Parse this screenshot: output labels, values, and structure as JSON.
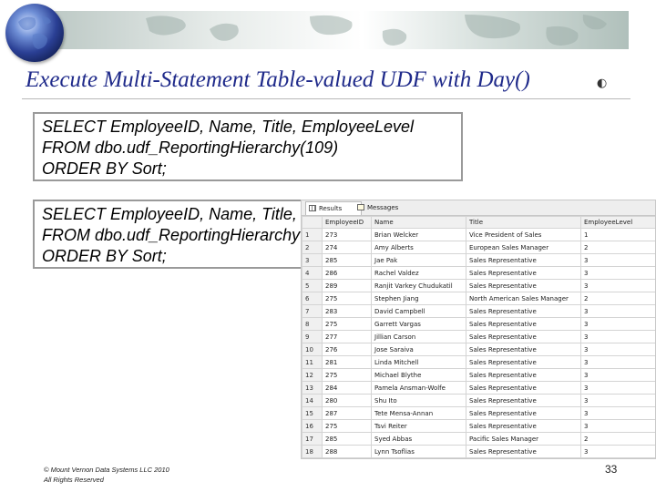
{
  "slide": {
    "title": "Execute Multi-Statement Table-valued UDF with Day()",
    "page_number": "33",
    "footer_lines": [
      "© Mount Vernon Data Systems LLC 2010",
      "All Rights Reserved"
    ],
    "icons": {
      "globe": "globe-icon",
      "title_marker": "audio-icon"
    }
  },
  "queries": [
    {
      "lines": [
        "SELECT EmployeeID, Name, Title, EmployeeLevel",
        "FROM dbo.udf_ReportingHierarchy(109)",
        "ORDER BY Sort;"
      ]
    },
    {
      "lines": [
        "SELECT EmployeeID, Name, Title, EmployeeLevel",
        "FROM dbo.udf_ReportingHierarchy(109)",
        "ORDER BY Sort;"
      ]
    }
  ],
  "results": {
    "tabs": [
      "Results",
      "Messages"
    ],
    "columns": [
      "",
      "EmployeeID",
      "Name",
      "Title",
      "EmployeeLevel"
    ],
    "rows": [
      [
        "1",
        "273",
        "Brian Welcker",
        "Vice President of Sales",
        "1"
      ],
      [
        "2",
        "274",
        "Amy Alberts",
        "European Sales Manager",
        "2"
      ],
      [
        "3",
        "285",
        "Jae Pak",
        "Sales Representative",
        "3"
      ],
      [
        "4",
        "286",
        "Rachel Valdez",
        "Sales Representative",
        "3"
      ],
      [
        "5",
        "289",
        "Ranjit Varkey Chudukatil",
        "Sales Representative",
        "3"
      ],
      [
        "6",
        "275",
        "Stephen Jiang",
        "North American Sales Manager",
        "2"
      ],
      [
        "7",
        "283",
        "David Campbell",
        "Sales Representative",
        "3"
      ],
      [
        "8",
        "275",
        "Garrett Vargas",
        "Sales Representative",
        "3"
      ],
      [
        "9",
        "277",
        "Jillian Carson",
        "Sales Representative",
        "3"
      ],
      [
        "10",
        "276",
        "Jose Saraiva",
        "Sales Representative",
        "3"
      ],
      [
        "11",
        "281",
        "Linda Mitchell",
        "Sales Representative",
        "3"
      ],
      [
        "12",
        "275",
        "Michael Blythe",
        "Sales Representative",
        "3"
      ],
      [
        "13",
        "284",
        "Pamela Ansman-Wolfe",
        "Sales Representative",
        "3"
      ],
      [
        "14",
        "280",
        "Shu Ito",
        "Sales Representative",
        "3"
      ],
      [
        "15",
        "287",
        "Tete Mensa-Annan",
        "Sales Representative",
        "3"
      ],
      [
        "16",
        "275",
        "Tsvi Reiter",
        "Sales Representative",
        "3"
      ],
      [
        "17",
        "285",
        "Syed Abbas",
        "Pacific Sales Manager",
        "2"
      ],
      [
        "18",
        "288",
        "Lynn Tsoflias",
        "Sales Representative",
        "3"
      ]
    ]
  }
}
